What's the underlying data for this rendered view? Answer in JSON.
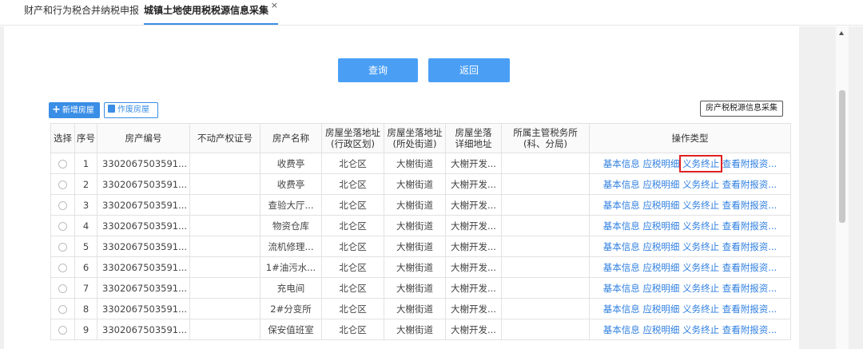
{
  "tabs": [
    {
      "label": "财产和行为税合并纳税申报"
    },
    {
      "label": "城镇土地使用税税源信息采集",
      "close": "×"
    }
  ],
  "buttons": {
    "query": "查询",
    "back": "返回",
    "add_house": "新增房屋",
    "void_house": "作废房屋",
    "collect": "房产税税源信息采集"
  },
  "table": {
    "headers": [
      "选择",
      "序号",
      "房产编号",
      "不动产权证号",
      "房产名称",
      "房屋坐落地址\n(行政区划)",
      "房屋坐落地址\n(所处街道)",
      "房屋坐落\n详细地址",
      "所属主管税务所\n(科、分局)",
      "操作类型"
    ],
    "rows": [
      {
        "no": "1",
        "id": "3302067503591...",
        "cert": "",
        "name": "收费亭",
        "district": "北仑区",
        "street": "大榭街道",
        "detail": "大榭开发...",
        "office": ""
      },
      {
        "no": "2",
        "id": "3302067503591...",
        "cert": "",
        "name": "收费亭",
        "district": "北仑区",
        "street": "大榭街道",
        "detail": "大榭开发...",
        "office": ""
      },
      {
        "no": "3",
        "id": "3302067503591...",
        "cert": "",
        "name": "查验大厅...",
        "district": "北仑区",
        "street": "大榭街道",
        "detail": "大榭开发...",
        "office": ""
      },
      {
        "no": "4",
        "id": "3302067503591...",
        "cert": "",
        "name": "物资仓库",
        "district": "北仑区",
        "street": "大榭街道",
        "detail": "大榭开发...",
        "office": ""
      },
      {
        "no": "5",
        "id": "3302067503591...",
        "cert": "",
        "name": "流机修理...",
        "district": "北仑区",
        "street": "大榭街道",
        "detail": "大榭开发...",
        "office": ""
      },
      {
        "no": "6",
        "id": "3302067503591...",
        "cert": "",
        "name": "1#油污水...",
        "district": "北仑区",
        "street": "大榭街道",
        "detail": "大榭开发...",
        "office": ""
      },
      {
        "no": "7",
        "id": "3302067503591...",
        "cert": "",
        "name": "充电间",
        "district": "北仑区",
        "street": "大榭街道",
        "detail": "大榭开发...",
        "office": ""
      },
      {
        "no": "8",
        "id": "3302067503591...",
        "cert": "",
        "name": "2#分变所",
        "district": "北仑区",
        "street": "大榭街道",
        "detail": "大榭开发...",
        "office": ""
      },
      {
        "no": "9",
        "id": "3302067503591...",
        "cert": "",
        "name": "保安值班室",
        "district": "北仑区",
        "street": "大榭街道",
        "detail": "大榭开发...",
        "office": ""
      }
    ],
    "actions": [
      "基本信息",
      "应税明细",
      "义务终止",
      "查看附报资..."
    ]
  },
  "highlight": {
    "row": 0,
    "action": 2,
    "color": "#e02020"
  },
  "colors": {
    "accent": "#4a9ff5",
    "link": "#2f7fe0"
  }
}
